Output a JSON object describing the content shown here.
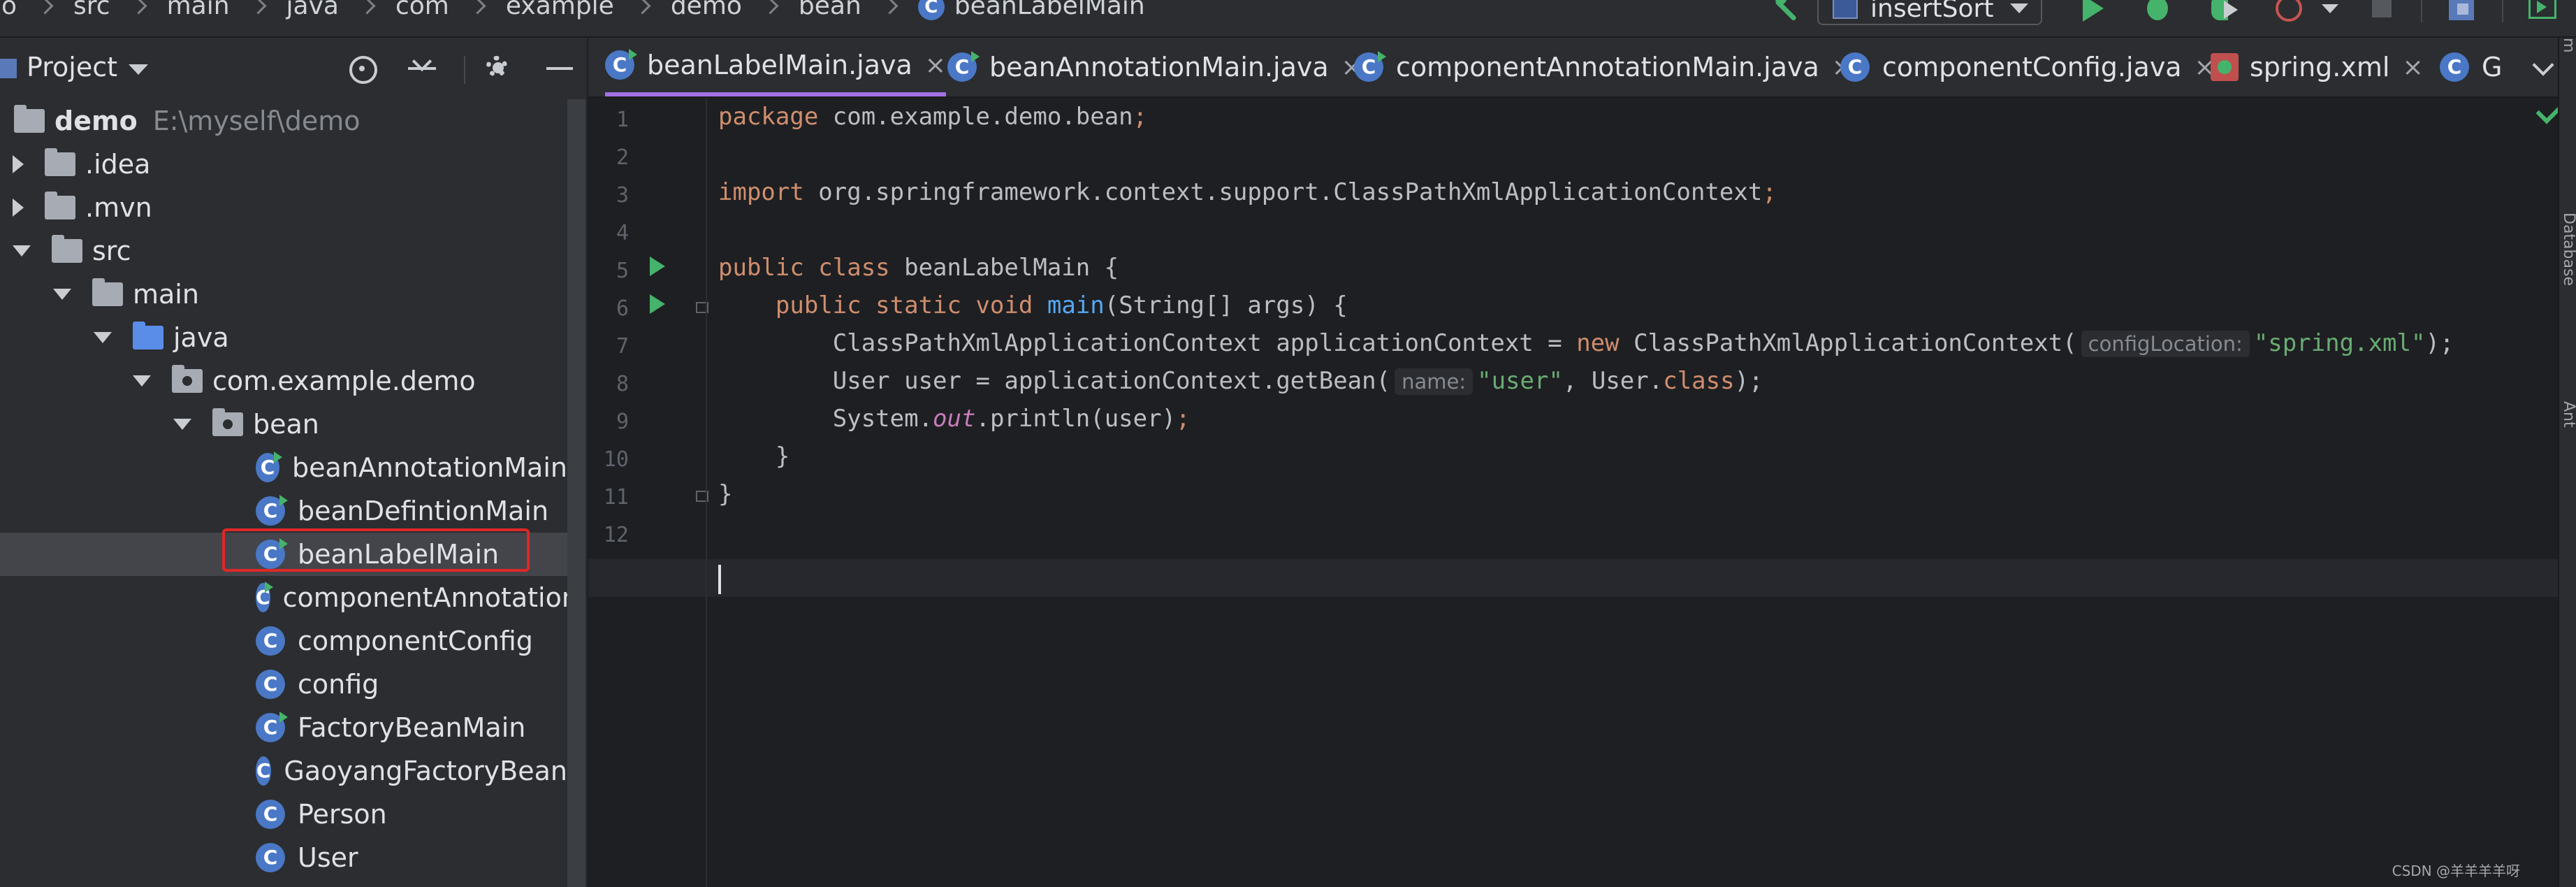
{
  "breadcrumbs": {
    "items": [
      "o",
      "src",
      "main",
      "java",
      "com",
      "example",
      "demo",
      "bean",
      "beanLabelMain"
    ],
    "last_icon_letter": "C"
  },
  "toolbar": {
    "run_config": "insertSort",
    "icons": [
      "hammer-icon",
      "run-icon",
      "debug-icon",
      "coverage-icon",
      "profile-icon",
      "stop-icon",
      "project-structure-icon",
      "terminal-icon"
    ]
  },
  "sidebar": {
    "title": "Project",
    "tree": [
      {
        "label": "demo",
        "path": "E:\\myself\\demo"
      },
      {
        "label": ".idea"
      },
      {
        "label": ".mvn"
      },
      {
        "label": "src"
      },
      {
        "label": "main"
      },
      {
        "label": "java"
      },
      {
        "label": "com.example.demo"
      },
      {
        "label": "bean"
      },
      {
        "label": "beanAnnotationMain"
      },
      {
        "label": "beanDefintionMain"
      },
      {
        "label": "beanLabelMain"
      },
      {
        "label": "componentAnnotationMain"
      },
      {
        "label": "componentConfig"
      },
      {
        "label": "config"
      },
      {
        "label": "FactoryBeanMain"
      },
      {
        "label": "GaoyangFactoryBean"
      },
      {
        "label": "Person"
      },
      {
        "label": "User"
      }
    ],
    "class_icon_letter": "C"
  },
  "tabs": [
    {
      "label": "beanLabelMain.java",
      "close": "×"
    },
    {
      "label": "beanAnnotationMain.java",
      "close": "×"
    },
    {
      "label": "componentAnnotationMain.java",
      "close": "×"
    },
    {
      "label": "componentConfig.java",
      "close": "×"
    },
    {
      "label": "spring.xml",
      "close": "×"
    },
    {
      "label": "G"
    }
  ],
  "editor": {
    "line_numbers": [
      "1",
      "2",
      "3",
      "4",
      "5",
      "6",
      "7",
      "8",
      "9",
      "10",
      "11",
      "12"
    ],
    "code": {
      "l1_kw": "package",
      "l1_rest": " com.example.demo.bean",
      "l1_semi": ";",
      "l3_kw": "import",
      "l3_rest": " org.springframework.context.support.ClassPathXmlApplicationContext",
      "l3_semi": ";",
      "l5_kw": "public class",
      "l5_rest": " beanLabelMain {",
      "l6_indent": "    ",
      "l6_kw": "public static void",
      "l6_sp": " ",
      "l6_fn": "main",
      "l6_rest": "(String[] args) {",
      "l7_a": "        ClassPathXmlApplicationContext applicationContext = ",
      "l7_new": "new",
      "l7_b": " ClassPathXmlApplicationContext(",
      "l7_hint": "configLocation:",
      "l7_str": "\"spring.xml\"",
      "l7_end": ");",
      "l8_a": "        User user = applicationContext.getBean(",
      "l8_hint": "name:",
      "l8_str": "\"user\"",
      "l8_b": ", User.",
      "l8_kw": "class",
      "l8_end": ");",
      "l9_a": "        System.",
      "l9_static": "out",
      "l9_b": ".println(user)",
      "l9_semi": ";",
      "l10": "    }",
      "l11": "}"
    }
  },
  "right_strip": [
    "m",
    "Database",
    "Ant"
  ],
  "watermark": "CSDN @羊羊羊羊呀",
  "colors": {
    "keyword": "#cf8e6d",
    "function": "#56a8f5",
    "string": "#6aab73",
    "static_field": "#c77dbb",
    "run_green": "#45b36b",
    "active_tab_underline": "#a571e6",
    "highlight_box": "#e02727"
  }
}
